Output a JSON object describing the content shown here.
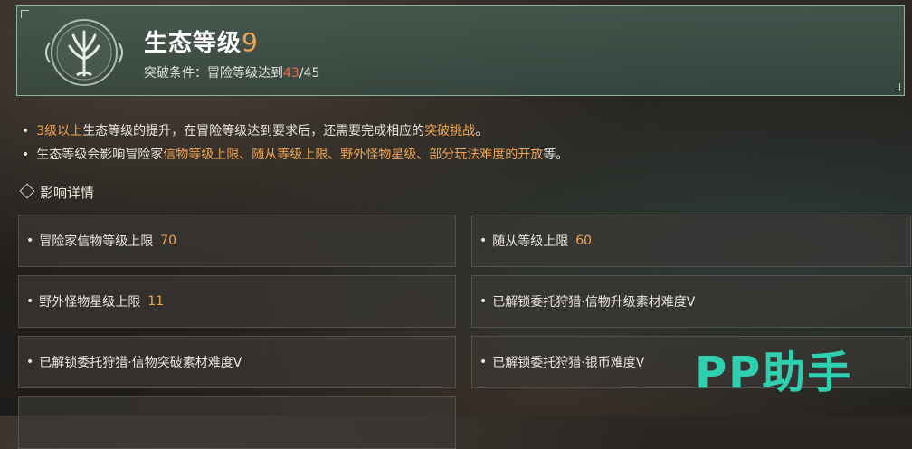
{
  "header": {
    "title": "生态等级",
    "level": "9",
    "condition_label": "突破条件：冒险等级达到",
    "condition_current": "43",
    "condition_total": "/45"
  },
  "notes": [
    {
      "parts": [
        {
          "t": "3级以上",
          "hl": true
        },
        {
          "t": "生态等级的提升，在冒险等级达到要求后，还需要完成相应的",
          "hl": false
        },
        {
          "t": "突破挑战",
          "hl": true
        },
        {
          "t": "。",
          "hl": false
        }
      ]
    },
    {
      "parts": [
        {
          "t": "生态等级会影响冒险家",
          "hl": false
        },
        {
          "t": "信物等级上限、随从等级上限、野外怪物星级、部分玩法难度的开放",
          "hl": true
        },
        {
          "t": "等。",
          "hl": false
        }
      ]
    }
  ],
  "section_title": "影响详情",
  "effects": [
    {
      "label": "冒险家信物等级上限",
      "value": "70"
    },
    {
      "label": "随从等级上限",
      "value": "60"
    },
    {
      "label": "野外怪物星级上限",
      "value": "11"
    },
    {
      "label": "已解锁委托狩猎·信物升级素材难度V",
      "value": ""
    },
    {
      "label": "已解锁委托狩猎·信物突破素材难度V",
      "value": ""
    },
    {
      "label": "已解锁委托狩猎·银币难度V",
      "value": ""
    }
  ],
  "watermark": "PP助手",
  "colors": {
    "accent": "#f0a451",
    "current_level": "#ef6a4a",
    "header_bg": "#465c52",
    "watermark": "#2fd0b0"
  }
}
